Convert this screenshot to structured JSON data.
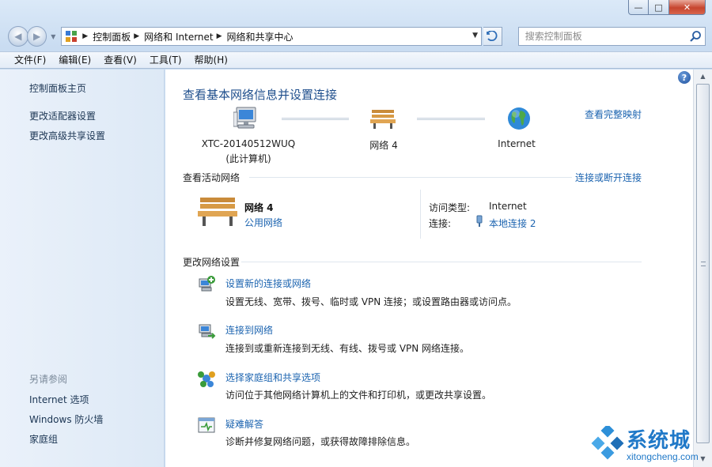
{
  "window": {
    "minimize_glyph": "—",
    "maximize_glyph": "□",
    "close_glyph": "✕"
  },
  "nav": {
    "back_glyph": "◀",
    "forward_glyph": "▶",
    "breadcrumbs": [
      "控制面板",
      "网络和 Internet",
      "网络和共享中心"
    ],
    "search_placeholder": "搜索控制面板"
  },
  "menu": [
    "文件(F)",
    "编辑(E)",
    "查看(V)",
    "工具(T)",
    "帮助(H)"
  ],
  "sidebar": {
    "top_links": [
      "控制面板主页",
      "更改适配器设置",
      "更改高级共享设置"
    ],
    "see_also_heading": "另请参阅",
    "see_also_links": [
      "Internet 选项",
      "Windows 防火墙",
      "家庭组"
    ]
  },
  "main": {
    "help_glyph": "?",
    "title": "查看基本网络信息并设置连接",
    "view_full_map": "查看完整映射",
    "map": {
      "computer_name": "XTC-20140512WUQ",
      "computer_sub": "(此计算机)",
      "network_name": "网络  4",
      "internet_name": "Internet"
    },
    "active_networks": {
      "heading": "查看活动网络",
      "connect_link": "连接或断开连接",
      "network_name": "网络  4",
      "network_type": "公用网络",
      "access_type_label": "访问类型:",
      "access_type_value": "Internet",
      "connections_label": "连接:",
      "connections_value": "本地连接 2"
    },
    "change_settings": {
      "heading": "更改网络设置",
      "tasks": [
        {
          "icon": "new-connection-icon",
          "link": "设置新的连接或网络",
          "desc": "设置无线、宽带、拨号、临时或 VPN 连接；或设置路由器或访问点。"
        },
        {
          "icon": "connect-network-icon",
          "link": "连接到网络",
          "desc": "连接到或重新连接到无线、有线、拨号或 VPN 网络连接。"
        },
        {
          "icon": "homegroup-icon",
          "link": "选择家庭组和共享选项",
          "desc": "访问位于其他网络计算机上的文件和打印机，或更改共享设置。"
        },
        {
          "icon": "troubleshoot-icon",
          "link": "疑难解答",
          "desc": "诊断并修复网络问题，或获得故障排除信息。"
        }
      ]
    }
  },
  "watermark": {
    "brand": "系统城",
    "url": "xitongcheng.com"
  },
  "colors": {
    "link": "#1c64b0",
    "title": "#1e4e8c",
    "sidebar_bg": "#e3edf8",
    "watermark": "#2079c8"
  }
}
